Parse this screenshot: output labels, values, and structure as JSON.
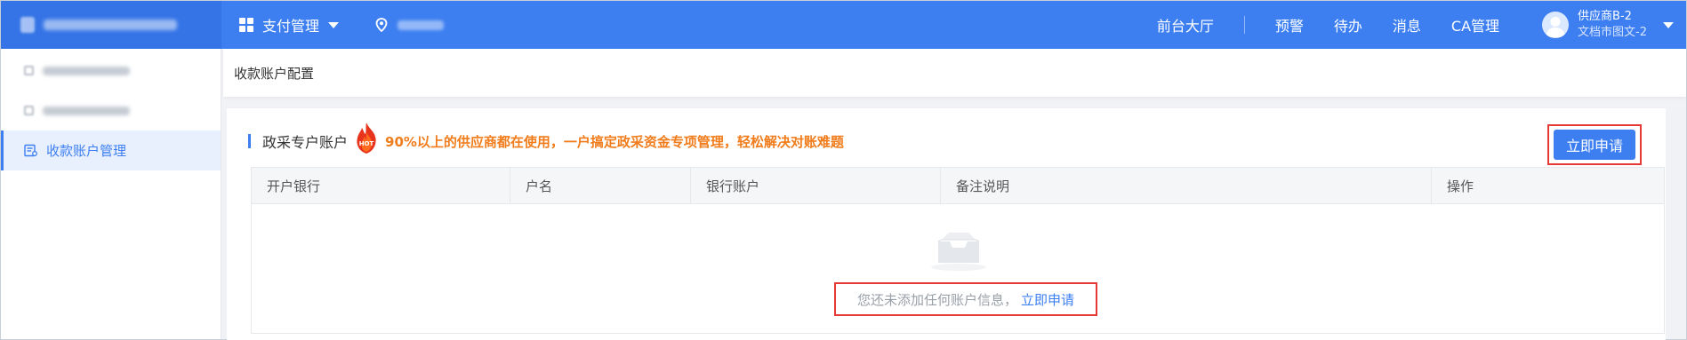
{
  "topbar": {
    "menu_label": "支付管理",
    "nav_items": [
      "前台大厅",
      "预警",
      "待办",
      "消息",
      "CA管理"
    ],
    "user_name": "供应商B-2",
    "user_org": "文档市图文-2"
  },
  "sidebar": {
    "active_label": "收款账户管理"
  },
  "breadcrumb": "收款账户配置",
  "section": {
    "title": "政采专户账户",
    "hot_badge": "HOT",
    "promo": "90%以上的供应商都在使用，一户搞定政采资金专项管理，轻松解决对账难题",
    "apply_button": "立即申请"
  },
  "table": {
    "columns": [
      "开户银行",
      "户名",
      "银行账户",
      "备注说明",
      "操作"
    ],
    "empty_text": "您还未添加任何账户信息，",
    "empty_link": "立即申请"
  },
  "colors": {
    "primary": "#3d7ff1",
    "promo": "#f07c1b",
    "highlight": "#e53935"
  }
}
